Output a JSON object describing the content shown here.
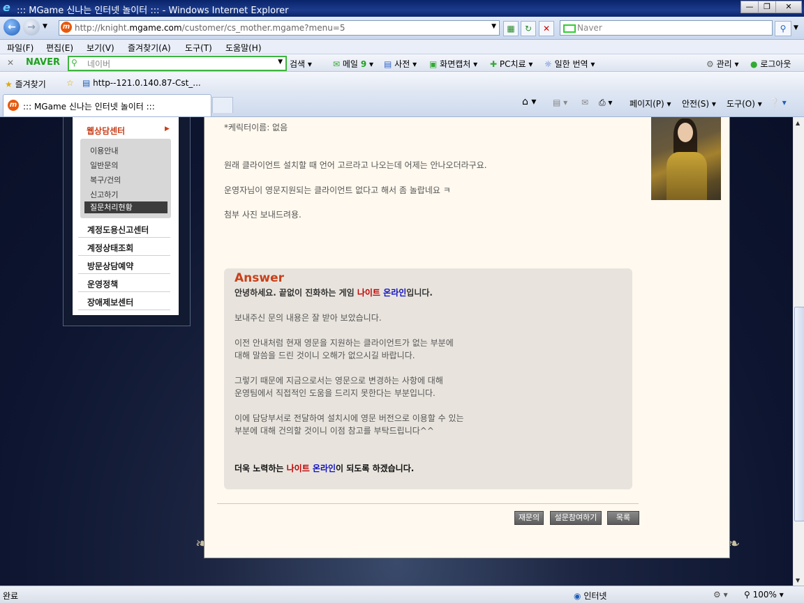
{
  "window": {
    "title": "::: MGame 신나는 인터넷 놀이터 ::: - Windows Internet Explorer"
  },
  "address": {
    "url_prefix": "http://knight.",
    "url_domain": "mgame.com",
    "url_path": "/customer/cs_mother.mgame?menu=5",
    "search_placeholder": "Naver"
  },
  "menu": {
    "items": [
      "파일(F)",
      "편집(E)",
      "보기(V)",
      "즐겨찾기(A)",
      "도구(T)",
      "도움말(H)"
    ]
  },
  "naver_toolbar": {
    "brand": "NAVER",
    "search_placeholder": "네이버",
    "search": "검색",
    "mail": "메일",
    "mail_count": "9",
    "dictionary": "사전",
    "capture": "화면캡처",
    "pc_cure": "PC치료",
    "translate": "일한 번역",
    "manage": "관리",
    "logout": "로그아웃"
  },
  "favorites": {
    "label": "즐겨찾기",
    "link": "http--121.0.140.87-Cst_..."
  },
  "tab": {
    "title": "::: MGame 신나는 인터넷 놀이터 :::"
  },
  "commands": {
    "page": "페이지(P)",
    "safety": "안전(S)",
    "tools": "도구(O)"
  },
  "sidebar": {
    "section": "웹상담센터",
    "subitems": [
      "이용안내",
      "일반문의",
      "복구/건의",
      "신고하기",
      "질문처리현황"
    ],
    "items": [
      "계정도용신고센터",
      "계정상태조회",
      "방문상담예약",
      "운영정책",
      "장애제보센터"
    ]
  },
  "question": {
    "lines": [
      "*케릭터이름: 없음",
      "원래 클라이언트 설치할 때 언어 고르라고 나오는데 어제는 안나오더라구요.",
      "운영자님이 영문지원되는 클라이언트 없다고 해서 좀 놀랍네요 ㅋ",
      "첨부 사진 보내드려용."
    ]
  },
  "answer": {
    "heading": "Answer",
    "greeting_pre": "안녕하세요.  끝없이 진화하는 게임 ",
    "greeting_knight": "나이트",
    "greeting_space": " ",
    "greeting_online": "온라인",
    "greeting_post": "입니다.",
    "lines": [
      "보내주신 문의 내용은 잘 받아 보았습니다.",
      "이전 안내처럼 현재 영문을 지원하는 클라이언트가 없는 부분에",
      "대해 말씀을 드린 것이니 오해가 없으시길 바랍니다.",
      "그렇기 때문에 지금으로서는 영문으로 변경하는 사항에 대해",
      "운영팀에서 직접적인 도움을 드리지 못한다는 부분입니다.",
      "이에 담당부서로 전달하여 설치시에 영문 버전으로 이용할 수 있는",
      "부분에 대해 건의할 것이니 이점 참고를 부탁드립니다^^"
    ],
    "closing_pre": "더욱 노력하는 ",
    "closing_knight": "나이트",
    "closing_space": " ",
    "closing_online": "온라인",
    "closing_post": "이 되도록 하겠습니다."
  },
  "buttons": {
    "reask": "재문의",
    "survey": "설문참여하기",
    "list": "목록"
  },
  "status": {
    "left": "완료",
    "zone": "인터넷",
    "zoom": "100%"
  },
  "colors": {
    "accent_orange": "#c8401a",
    "knight_red": "#c00000",
    "online_blue": "#1010c0"
  }
}
